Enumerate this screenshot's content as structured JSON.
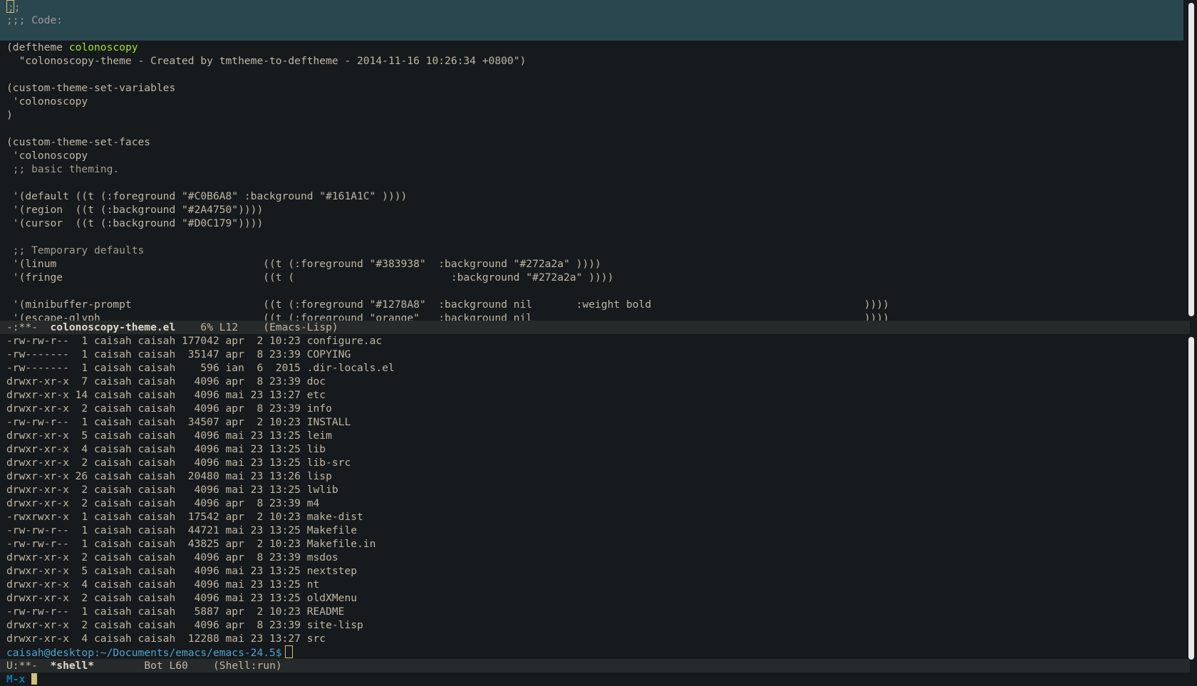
{
  "editor": {
    "lines": [
      {
        "text": ";;",
        "style": "comment",
        "cursor": true,
        "highlight": true
      },
      {
        "text": ";;; Code:",
        "style": "comment",
        "highlight": true
      },
      {
        "text": "",
        "highlight": true
      },
      {
        "text": "(deftheme colonoscopy"
      },
      {
        "text": "  \"colonoscopy-theme - Created by tmtheme-to-deftheme - 2014-11-16 10:26:34 +0800\")"
      },
      {
        "text": ""
      },
      {
        "text": "(custom-theme-set-variables"
      },
      {
        "text": " 'colonoscopy"
      },
      {
        "text": ")"
      },
      {
        "text": ""
      },
      {
        "text": "(custom-theme-set-faces"
      },
      {
        "text": " 'colonoscopy"
      },
      {
        "text": " ;; basic theming.",
        "style": "comment"
      },
      {
        "text": ""
      },
      {
        "text": " '(default ((t (:foreground \"#C0B6A8\" :background \"#161A1C\" ))))"
      },
      {
        "text": " '(region  ((t (:background \"#2A4750\"))))"
      },
      {
        "text": " '(cursor  ((t (:background \"#D0C179\"))))"
      },
      {
        "text": ""
      },
      {
        "text": " ;; Temporary defaults",
        "style": "comment"
      },
      {
        "text": " '(linum                                 ((t (:foreground \"#383938\"  :background \"#272a2a\" ))))"
      },
      {
        "text": " '(fringe                                ((t (                         :background \"#272a2a\" ))))"
      },
      {
        "text": ""
      },
      {
        "text": " '(minibuffer-prompt                     ((t (:foreground \"#1278A8\"  :background nil       :weight bold                                  ))))"
      },
      {
        "text": " '(escape-glyph                          ((t (:foreground \"orange\"   :background nil                                                     ))))"
      }
    ],
    "modeline": {
      "status": "-:**-",
      "buffer": "colonoscopy-theme.el",
      "position": "6% L12",
      "mode": "(Emacs-Lisp)"
    }
  },
  "shell": {
    "lines": [
      "-rw-rw-r--  1 caisah caisah 177042 apr  2 10:23 configure.ac",
      "-rw-------  1 caisah caisah  35147 apr  8 23:39 COPYING",
      "-rw-------  1 caisah caisah    596 ian  6  2015 .dir-locals.el",
      "drwxr-xr-x  7 caisah caisah   4096 apr  8 23:39 doc",
      "drwxr-xr-x 14 caisah caisah   4096 mai 23 13:27 etc",
      "drwxr-xr-x  2 caisah caisah   4096 apr  8 23:39 info",
      "-rw-rw-r--  1 caisah caisah  34507 apr  2 10:23 INSTALL",
      "drwxr-xr-x  5 caisah caisah   4096 mai 23 13:25 leim",
      "drwxr-xr-x  4 caisah caisah   4096 mai 23 13:25 lib",
      "drwxr-xr-x  2 caisah caisah   4096 mai 23 13:25 lib-src",
      "drwxr-xr-x 26 caisah caisah  20480 mai 23 13:26 lisp",
      "drwxr-xr-x  2 caisah caisah   4096 mai 23 13:25 lwlib",
      "drwxr-xr-x  2 caisah caisah   4096 apr  8 23:39 m4",
      "-rwxrwxr-x  1 caisah caisah  17542 apr  2 10:23 make-dist",
      "-rw-rw-r--  1 caisah caisah  44721 mai 23 13:25 Makefile",
      "-rw-rw-r--  1 caisah caisah  43825 apr  2 10:23 Makefile.in",
      "drwxr-xr-x  2 caisah caisah   4096 apr  8 23:39 msdos",
      "drwxr-xr-x  5 caisah caisah   4096 mai 23 13:25 nextstep",
      "drwxr-xr-x  4 caisah caisah   4096 mai 23 13:25 nt",
      "drwxr-xr-x  2 caisah caisah   4096 mai 23 13:25 oldXMenu",
      "-rw-rw-r--  1 caisah caisah   5887 apr  2 10:23 README",
      "drwxr-xr-x  2 caisah caisah   4096 apr  8 23:39 site-lisp",
      "drwxr-xr-x  4 caisah caisah  12288 mai 23 13:27 src"
    ],
    "prompt": "caisah@desktop:~/Documents/emacs/emacs-24.5$",
    "modeline": {
      "status": "U:**-",
      "buffer": "*shell*",
      "position": "Bot L60",
      "mode": "(Shell:run)"
    }
  },
  "minibuffer": {
    "prompt": "M-x"
  },
  "colors": {
    "background": "#161A1C",
    "foreground": "#C0B6A8",
    "region": "#2A4750",
    "cursor": "#D0C179",
    "modeline": "#272A2A",
    "minibuffer_prompt": "#1278A8"
  }
}
